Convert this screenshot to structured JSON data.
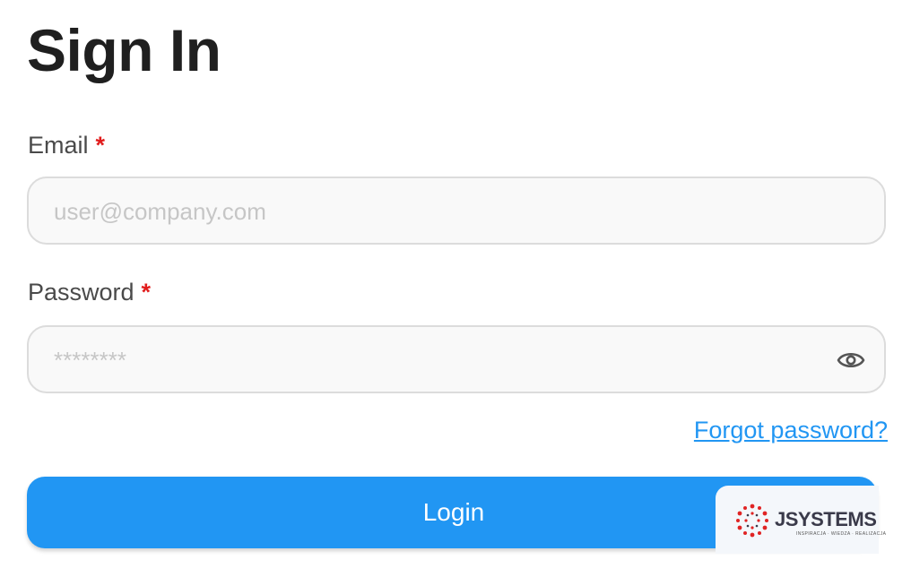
{
  "page": {
    "title": "Sign In"
  },
  "form": {
    "email": {
      "label": "Email",
      "required_marker": "*",
      "value": "",
      "placeholder": "user@company.com"
    },
    "password": {
      "label": "Password",
      "required_marker": "*",
      "value": "",
      "placeholder": "********",
      "toggle_icon": "eye-icon"
    },
    "forgot_password_label": "Forgot password?",
    "login_label": "Login"
  },
  "branding": {
    "logo_text": "JSYSTEMS",
    "tagline": "INSPIRACJA · WIEDZA · REALIZACJA"
  },
  "colors": {
    "accent": "#2196f3",
    "required": "#e11d1d",
    "input_background": "#f9f9f9",
    "input_border": "#dcdcdc",
    "title_text": "#1f1f1f",
    "logo_dots": "#e02424"
  }
}
